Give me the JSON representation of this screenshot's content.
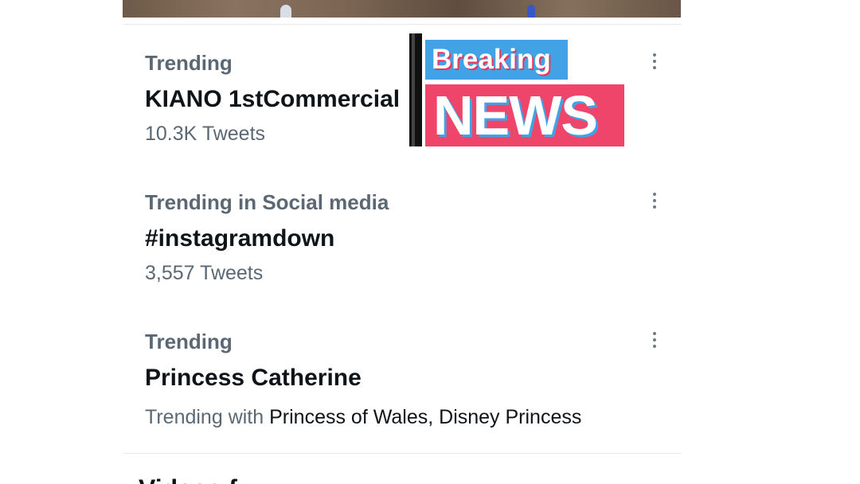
{
  "trends": [
    {
      "context": "Trending",
      "title": "KIANO 1stCommercial",
      "meta": "10.3K Tweets"
    },
    {
      "context": "Trending in Social media",
      "title": "#instagramdown",
      "meta": "3,557 Tweets"
    },
    {
      "context": "Trending",
      "title": "Princess Catherine",
      "meta_prefix": "Trending with",
      "meta_names": "Princess of Wales, Disney Princess"
    }
  ],
  "overlay": {
    "line1": "Breaking",
    "line2": "NEWS"
  },
  "next_section": {
    "heading": "Videos f"
  },
  "icons": {
    "more": "more-vertical-icon"
  },
  "colors": {
    "primary_text": "#0f1419",
    "secondary_text": "#5b6873",
    "news_red": "#f0456a",
    "news_blue": "#41a2e6"
  }
}
